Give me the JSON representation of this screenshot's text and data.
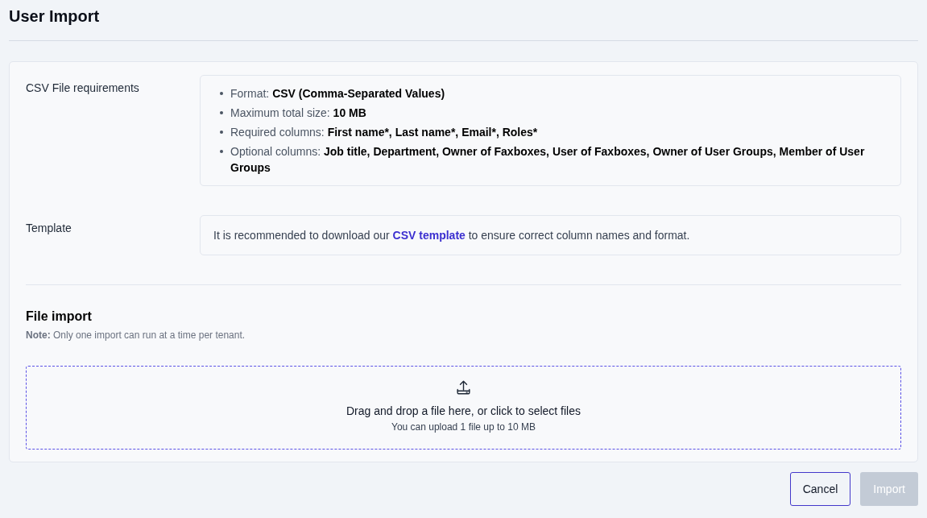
{
  "page": {
    "title": "User Import"
  },
  "requirements": {
    "label": "CSV File requirements",
    "items": [
      {
        "label": "Format:",
        "value": "CSV (Comma-Separated Values)"
      },
      {
        "label": "Maximum total size:",
        "value": "10 MB"
      },
      {
        "label": "Required columns:",
        "value": "First name*, Last name*, Email*, Roles*"
      },
      {
        "label": "Optional columns:",
        "value": "Job title, Department, Owner of Faxboxes, User of Faxboxes, Owner of User Groups, Member of User Groups"
      }
    ]
  },
  "template": {
    "label": "Template",
    "text_before": "It is recommended to download our",
    "link": "CSV template",
    "text_after": "to ensure correct column names and format."
  },
  "file_import": {
    "title": "File import",
    "note_label": "Note:",
    "note": "Only one import can run at a time per tenant.",
    "dropzone": {
      "prompt": "Drag and drop a file here, or click to select files",
      "hint": "You can upload 1 file up to 10 MB"
    }
  },
  "buttons": [
    {
      "label": "Cancel",
      "kind": "secondary",
      "disabled": false
    },
    {
      "label": "Import",
      "kind": "primary",
      "disabled": true
    }
  ]
}
